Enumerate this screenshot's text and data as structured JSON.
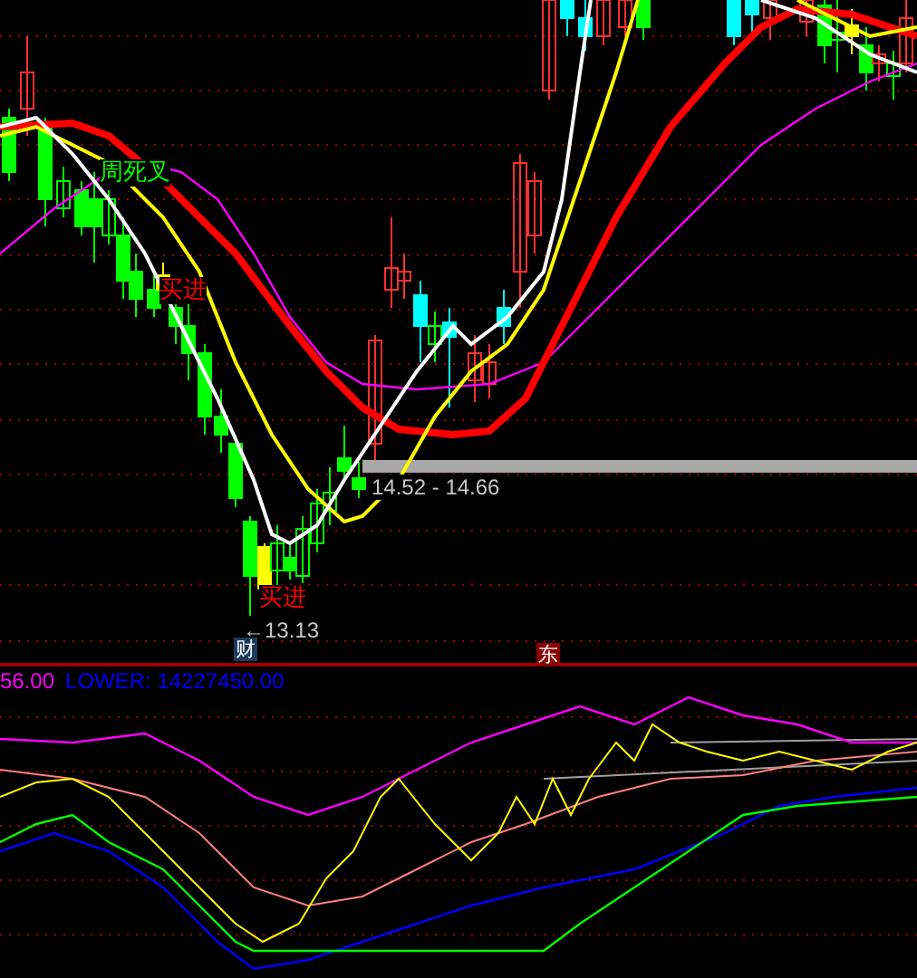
{
  "main_panel": {
    "signals": [
      {
        "text": "周死叉",
        "color": "#00ff00"
      },
      {
        "text": "买进",
        "color": "#ff0000"
      },
      {
        "text": "买进",
        "color": "#ff0000"
      }
    ],
    "price_range_label": "14.52 - 14.66",
    "low_price_label": "←13.13",
    "badges": [
      {
        "text": "财",
        "color": "#1b3a5c"
      },
      {
        "text": "东",
        "color": "#8b0000"
      }
    ]
  },
  "indicator_panel": {
    "values": [
      {
        "text": "56.00",
        "color": "#ff00ff"
      },
      {
        "text": "LOWER: 14227450.00",
        "color": "#0000ff"
      }
    ]
  }
}
